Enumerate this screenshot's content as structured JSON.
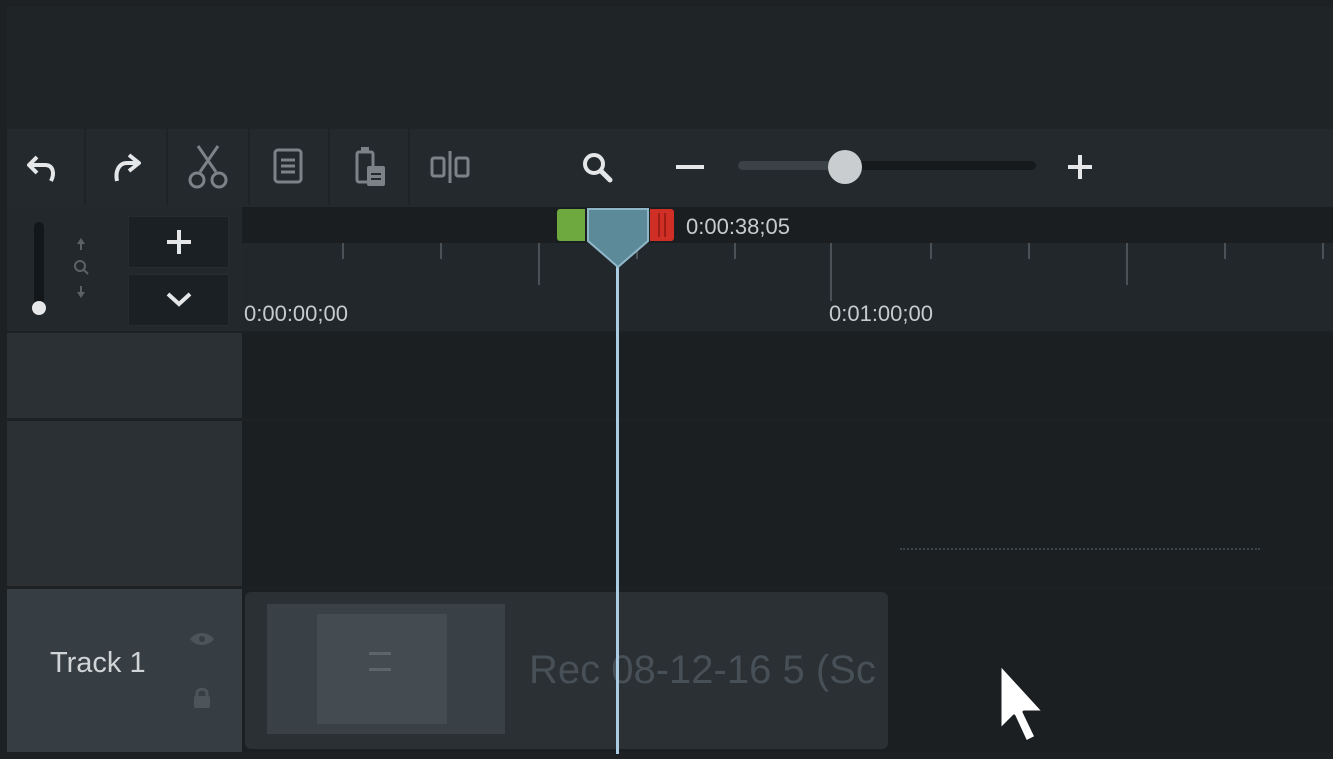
{
  "toolbar": {
    "icons": [
      "undo-icon",
      "redo-icon",
      "cut-icon",
      "copy-icon",
      "paste-icon",
      "split-icon",
      "zoom-search-icon",
      "zoom-out-icon",
      "zoom-in-icon"
    ]
  },
  "zoom": {
    "level": 0.36
  },
  "timeline": {
    "playhead_time": "0:00:38;05",
    "ruler_labels": [
      "0:00:00;00",
      "0:01:00;00"
    ]
  },
  "tracks": [
    {
      "name": "Track 1",
      "clip_title": "Rec 08-12-16 5 (Sc"
    }
  ],
  "colors": {
    "accent_playhead": "#5d8a99",
    "marker_in": "#6ea940",
    "marker_out": "#cf2f25"
  }
}
